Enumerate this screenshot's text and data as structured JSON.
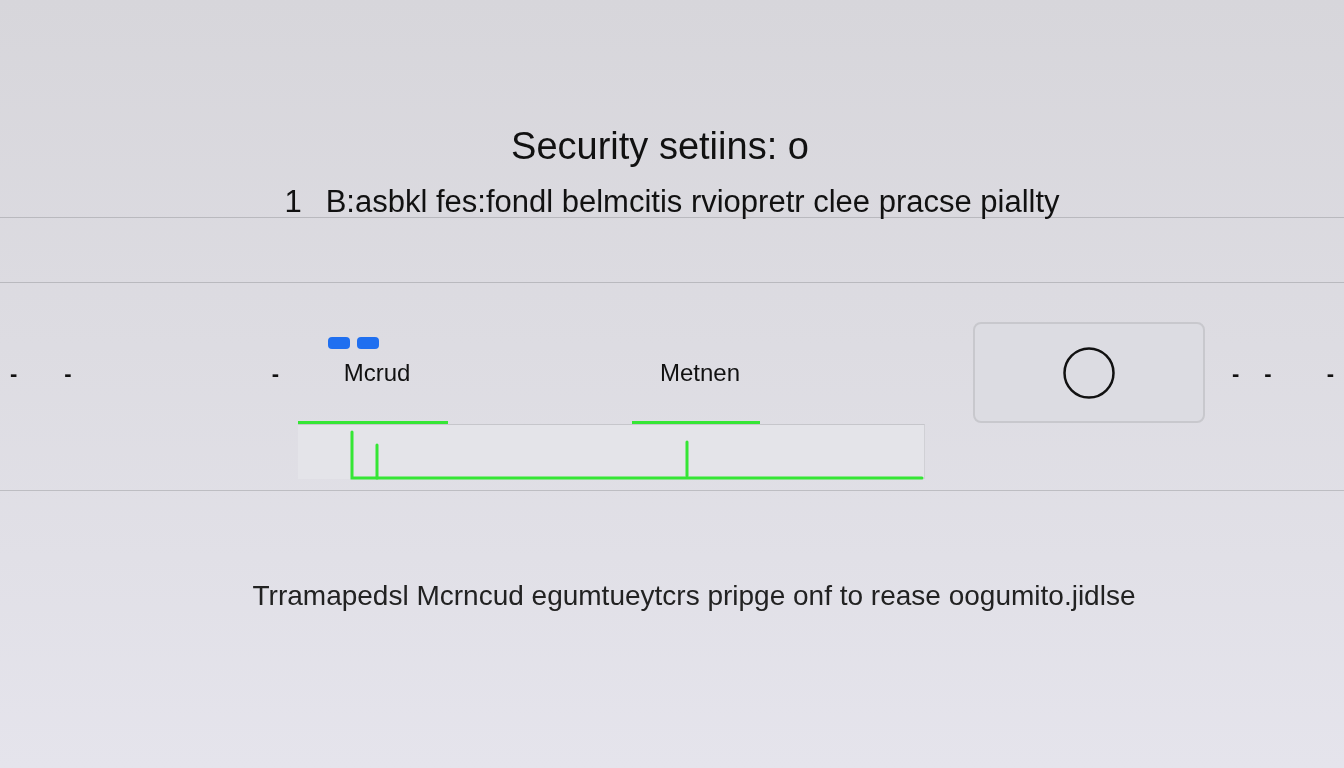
{
  "header": {
    "title": "Security setiins: o",
    "step_number": "1",
    "subtitle": "B:asbkl fes:fondl belmcitis rviopretr clee pracse piallty"
  },
  "toolbar": {
    "left_marks": [
      "-",
      "-",
      "-"
    ],
    "tabs": [
      {
        "label": "Mcrud",
        "selected": true,
        "badge": true
      },
      {
        "label": "Metnen",
        "selected": true,
        "badge": false
      }
    ],
    "right_marks": [
      "-",
      "-",
      "-"
    ]
  },
  "footer": {
    "text": "Trramapedsl Mcrncud egumtueytcrs pripge onf to rease oogumito.jidlse"
  }
}
